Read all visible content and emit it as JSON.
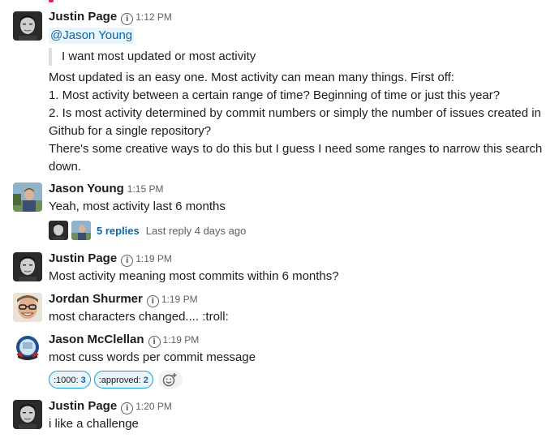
{
  "messages": [
    {
      "author": "Justin Page",
      "time": "1:12 PM",
      "mention": "@Jason Young",
      "quote": "I want most updated or most activity",
      "lines": [
        "Most updated is an easy one. Most activity can mean many things. First off:",
        "1. Most activity between a certain range of time? Beginning of time or just this year?",
        "2. Is most activity determined by commit numbers or simply the number of issues created in",
        "Github for a single repository?",
        "There's some creative ways to do this but I guess I need some ranges to narrow this search",
        "down."
      ]
    },
    {
      "author": "Jason Young",
      "time": "1:15 PM",
      "text": "Yeah, most activity last 6 months",
      "thread": {
        "replies": "5 replies",
        "last_reply": "Last reply 4 days ago"
      }
    },
    {
      "author": "Justin Page",
      "time": "1:19 PM",
      "text": "Most activity meaning most commits within 6 months?"
    },
    {
      "author": "Jordan Shurmer",
      "time": "1:19 PM",
      "text": "most characters changed.... :troll:"
    },
    {
      "author": "Jason McClellan",
      "time": "1:19 PM",
      "text": "most cuss words per commit message",
      "reactions": [
        {
          "emoji": ":1000:",
          "count": "3"
        },
        {
          "emoji": ":approved:",
          "count": "2"
        }
      ]
    },
    {
      "author": "Justin Page",
      "time": "1:20 PM",
      "text": "i like a challenge"
    }
  ],
  "colors": {
    "link": "#1264a3",
    "mention_bg": "#e8f5fa",
    "reaction_border": "#1d9bd1",
    "muted": "#616061"
  },
  "icons": [
    "info-icon",
    "add-reaction-icon"
  ]
}
